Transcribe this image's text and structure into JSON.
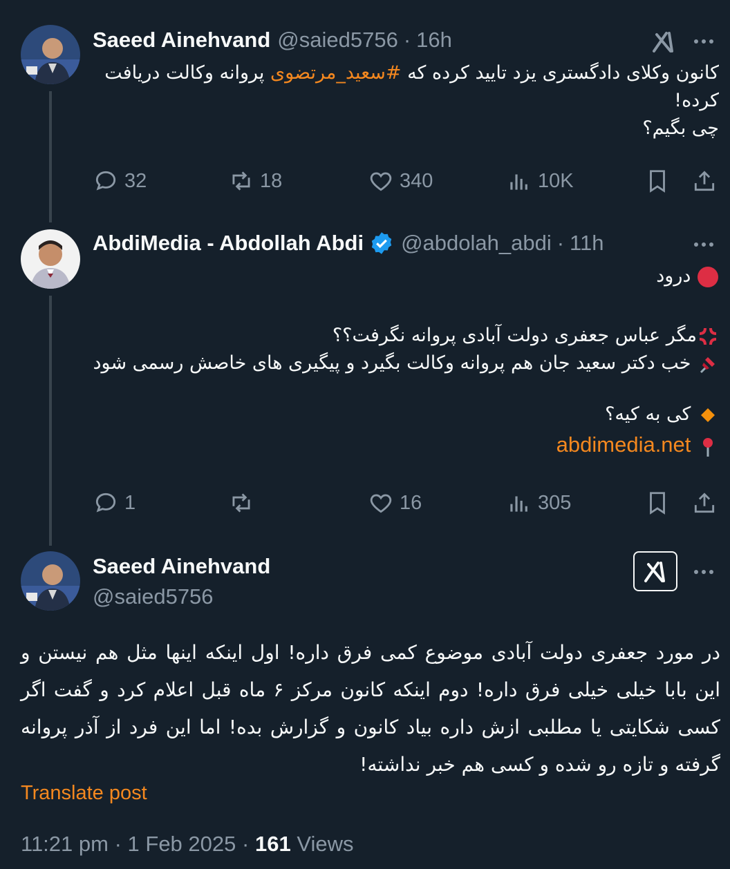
{
  "colors": {
    "background": "#15202b",
    "accent": "#f4881f",
    "muted": "#8b98a5",
    "verified": "#1d9bf0"
  },
  "tweet1": {
    "name": "Saeed Ainehvand",
    "handle": "@saied5756",
    "separator": "·",
    "time": "16h",
    "text_before": "کانون وکلای دادگستری یزد تایید کرده که ",
    "hashtag": "#سعید_مرتضوی",
    "text_after": " پروانه وکالت دریافت کرده!",
    "line2": "چی بگیم؟",
    "replies": "32",
    "reposts": "18",
    "likes": "340",
    "views": "10K"
  },
  "tweet2": {
    "name": "AbdiMedia - Abdollah Abdi",
    "handle": "@abdolah_abdi",
    "separator": "·",
    "time": "11h",
    "line1": "درود",
    "line2": "مگر عباس جعفری دولت آبادی پروانه نگرفت؟؟",
    "line3": "خب دکتر سعید جان هم پروانه وکالت بگیرد و پیگیری های خاصش رسمی شود",
    "line4": "کی به کیه؟",
    "link": "abdimedia.net",
    "replies": "1",
    "reposts": "",
    "likes": "16",
    "views": "305"
  },
  "main": {
    "name": "Saeed Ainehvand",
    "handle": "@saied5756",
    "text": "در مورد جعفری دولت آبادی موضوع کمی فرق داره! اول اینکه  اینها مثل هم نیستن و این بابا خیلی خیلی فرق داره! دوم اینکه کانون مرکز ۶ ماه قبل اعلام کرد و گفت اگر کسی شکایتی یا مطلبی ازش داره بیاد کانون و گزارش بده! اما این فرد از آذر  پروانه گرفته و تازه رو شده و کسی هم خبر نداشته!",
    "translate": "Translate post",
    "time": "11:21 pm",
    "separator": "·",
    "date": "1 Feb 2025",
    "views_count": "161",
    "views_label": "Views"
  },
  "icons": [
    "grok-icon",
    "more-icon",
    "reply-icon",
    "repost-icon",
    "like-icon",
    "views-icon",
    "bookmark-icon",
    "share-icon",
    "verified-icon"
  ]
}
